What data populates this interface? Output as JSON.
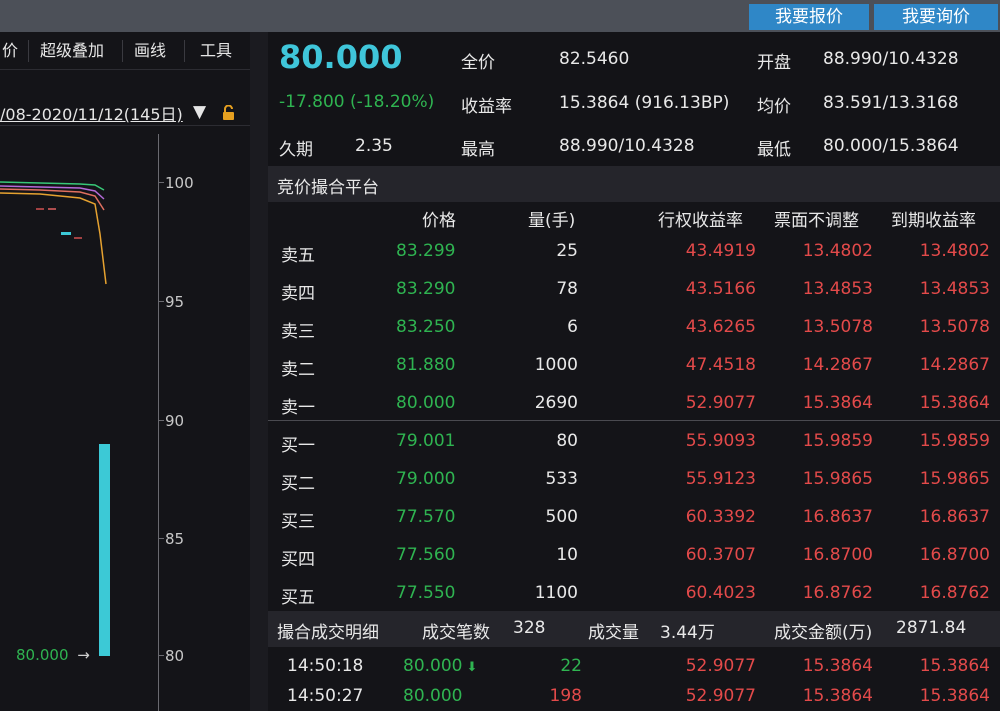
{
  "topbar": {
    "quote_button": "我要报价",
    "inquiry_button": "我要询价"
  },
  "left_toolbar": {
    "items": [
      "价",
      "超级叠加",
      "画线",
      "工具"
    ]
  },
  "chart": {
    "date_range": "/08-2020/11/12(145日)",
    "y_ticks": [
      "100",
      "95",
      "90",
      "85",
      "80"
    ],
    "last_price_label": "80.000",
    "colors": {
      "volume_bar": "#3cc9d6",
      "line1": "#38c878",
      "line2": "#b46ad8",
      "line3": "#e07060",
      "line4": "#e6a230"
    }
  },
  "quote": {
    "last_price": "80.000",
    "change": "-17.800 (-18.20%)",
    "duration_label": "久期",
    "duration_value": "2.35",
    "full_price_label": "全价",
    "full_price_value": "82.5460",
    "yield_label": "收益率",
    "yield_value": "15.3864 (916.13BP)",
    "high_label": "最高",
    "high_value": "88.990/10.4328",
    "open_label": "开盘",
    "open_value": "88.990/10.4328",
    "avg_label": "均价",
    "avg_value": "83.591/13.3168",
    "low_label": "最低",
    "low_value": "80.000/15.3864"
  },
  "order_book": {
    "title": "竞价撮合平台",
    "headers": {
      "price": "价格",
      "qty": "量(手)",
      "exercise_yield": "行权收益率",
      "coupon_unadj": "票面不调整",
      "maturity_yield": "到期收益率"
    },
    "asks": [
      {
        "label": "卖五",
        "price": "83.299",
        "qty": "25",
        "r1": "43.4919",
        "r2": "13.4802",
        "r3": "13.4802"
      },
      {
        "label": "卖四",
        "price": "83.290",
        "qty": "78",
        "r1": "43.5166",
        "r2": "13.4853",
        "r3": "13.4853"
      },
      {
        "label": "卖三",
        "price": "83.250",
        "qty": "6",
        "r1": "43.6265",
        "r2": "13.5078",
        "r3": "13.5078"
      },
      {
        "label": "卖二",
        "price": "81.880",
        "qty": "1000",
        "r1": "47.4518",
        "r2": "14.2867",
        "r3": "14.2867"
      },
      {
        "label": "卖一",
        "price": "80.000",
        "qty": "2690",
        "r1": "52.9077",
        "r2": "15.3864",
        "r3": "15.3864"
      }
    ],
    "bids": [
      {
        "label": "买一",
        "price": "79.001",
        "qty": "80",
        "r1": "55.9093",
        "r2": "15.9859",
        "r3": "15.9859"
      },
      {
        "label": "买二",
        "price": "79.000",
        "qty": "533",
        "r1": "55.9123",
        "r2": "15.9865",
        "r3": "15.9865"
      },
      {
        "label": "买三",
        "price": "77.570",
        "qty": "500",
        "r1": "60.3392",
        "r2": "16.8637",
        "r3": "16.8637"
      },
      {
        "label": "买四",
        "price": "77.560",
        "qty": "10",
        "r1": "60.3707",
        "r2": "16.8700",
        "r3": "16.8700"
      },
      {
        "label": "买五",
        "price": "77.550",
        "qty": "1100",
        "r1": "60.4023",
        "r2": "16.8762",
        "r3": "16.8762"
      }
    ]
  },
  "trades": {
    "title": "撮合成交明细",
    "count_label": "成交笔数",
    "count_value": "328",
    "volume_label": "成交量",
    "volume_value": "3.44万",
    "amount_label": "成交金额(万)",
    "amount_value": "2871.84",
    "rows": [
      {
        "time": "14:50:18",
        "price": "80.000",
        "vol": "22",
        "r1": "52.9077",
        "r2": "15.3864",
        "r3": "15.3864"
      },
      {
        "time": "14:50:27",
        "price": "80.000",
        "vol": "198",
        "r1": "52.9077",
        "r2": "15.3864",
        "r3": "15.3864"
      }
    ]
  }
}
